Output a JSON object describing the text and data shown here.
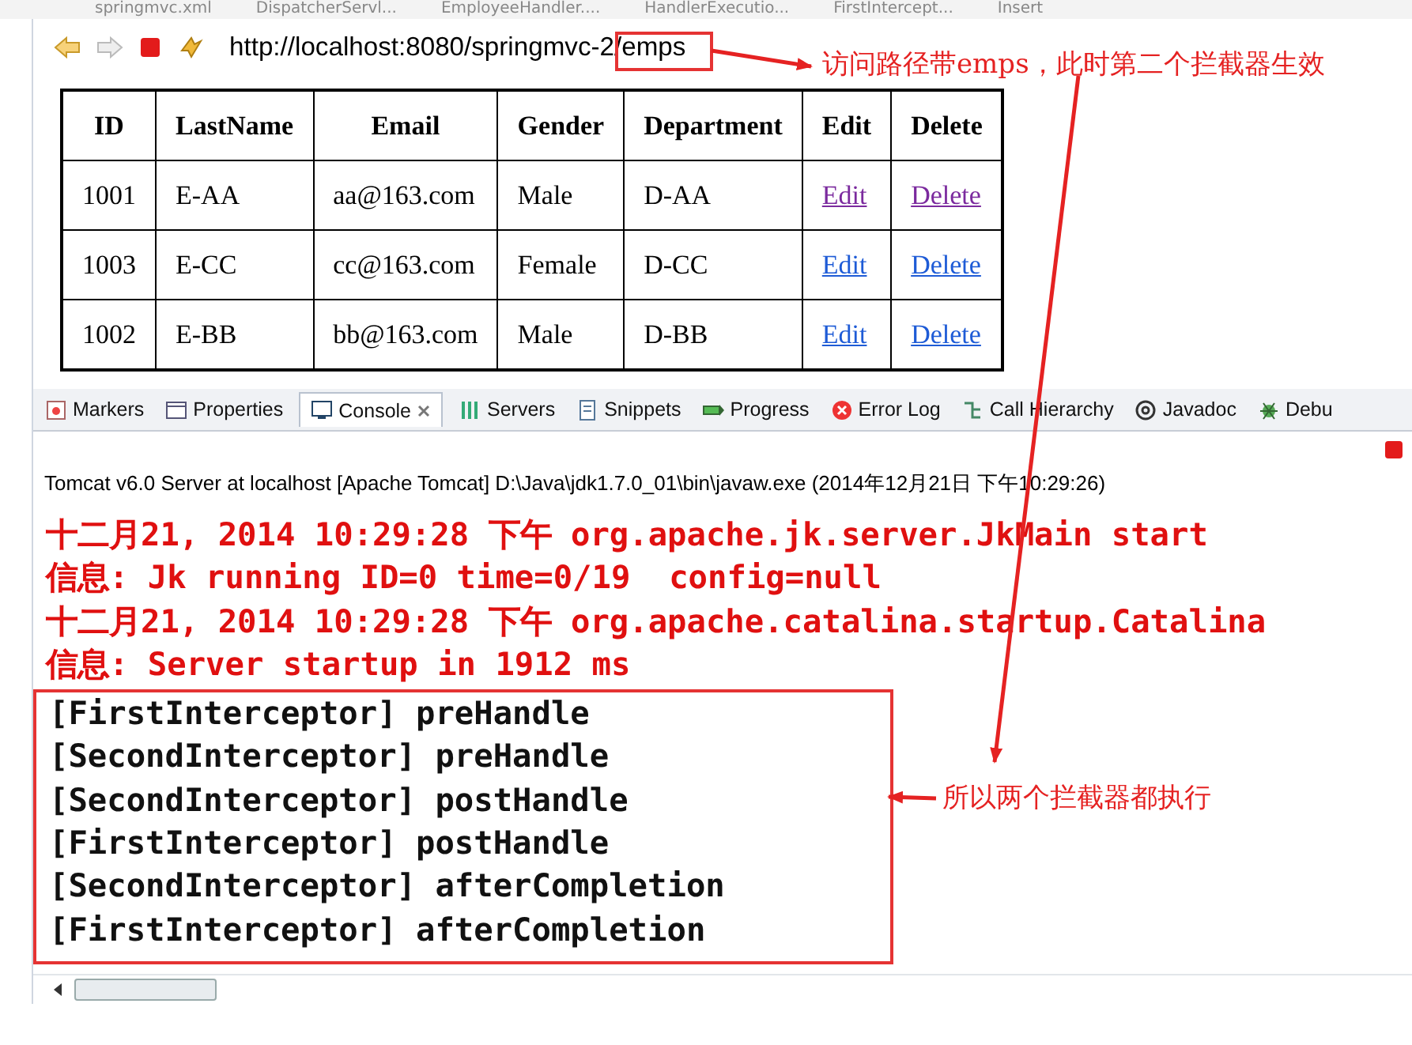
{
  "editor_tabs": [
    {
      "label": "springmvc.xml"
    },
    {
      "label": "DispatcherServl..."
    },
    {
      "label": "EmployeeHandler...."
    },
    {
      "label": "HandlerExecutio..."
    },
    {
      "label": "FirstIntercept..."
    },
    {
      "label": "Insert"
    }
  ],
  "browser": {
    "url": "http://localhost:8080/springmvc-2/emps"
  },
  "table": {
    "columns": [
      "ID",
      "LastName",
      "Email",
      "Gender",
      "Department",
      "Edit",
      "Delete"
    ],
    "rows": [
      {
        "cells": [
          "1001",
          "E-AA",
          "aa@163.com",
          "Male",
          "D-AA"
        ],
        "edit": "Edit",
        "delete": "Delete",
        "visited": true
      },
      {
        "cells": [
          "1003",
          "E-CC",
          "cc@163.com",
          "Female",
          "D-CC"
        ],
        "edit": "Edit",
        "delete": "Delete",
        "visited": false
      },
      {
        "cells": [
          "1002",
          "E-BB",
          "bb@163.com",
          "Male",
          "D-BB"
        ],
        "edit": "Edit",
        "delete": "Delete",
        "visited": false
      }
    ]
  },
  "view_tabs": [
    {
      "label": "Markers",
      "selected": false
    },
    {
      "label": "Properties",
      "selected": false
    },
    {
      "label": "Console",
      "selected": true
    },
    {
      "label": "Servers",
      "selected": false
    },
    {
      "label": "Snippets",
      "selected": false
    },
    {
      "label": "Progress",
      "selected": false
    },
    {
      "label": "Error Log",
      "selected": false
    },
    {
      "label": "Call Hierarchy",
      "selected": false
    },
    {
      "label": "Javadoc",
      "selected": false
    },
    {
      "label": "Debu",
      "selected": false
    }
  ],
  "console": {
    "header": "Tomcat v6.0 Server at localhost [Apache Tomcat] D:\\Java\\jdk1.7.0_01\\bin\\javaw.exe (2014年12月21日 下午10:29:26)",
    "lines": [
      {
        "text": "十二月21, 2014 10:29:28 下午 org.apache.jk.server.JkMain start",
        "kind": "error"
      },
      {
        "text": "信息: Jk running ID=0 time=0/19  config=null",
        "kind": "error"
      },
      {
        "text": "十二月21, 2014 10:29:28 下午 org.apache.catalina.startup.Catalina",
        "kind": "error"
      },
      {
        "text": "信息: Server startup in 1912 ms",
        "kind": "error"
      },
      {
        "text": "[FirstInterceptor] preHandle",
        "kind": "out"
      },
      {
        "text": "[SecondInterceptor] preHandle",
        "kind": "out"
      },
      {
        "text": "[SecondInterceptor] postHandle",
        "kind": "out"
      },
      {
        "text": "[FirstInterceptor] postHandle",
        "kind": "out"
      },
      {
        "text": "[SecondInterceptor] afterCompletion",
        "kind": "out"
      },
      {
        "text": "[FirstInterceptor] afterCompletion",
        "kind": "out"
      }
    ]
  },
  "annotations": [
    {
      "text": "访问路径带emps，此时第二个拦截器生效"
    },
    {
      "text": "所以两个拦截器都执行"
    }
  ]
}
